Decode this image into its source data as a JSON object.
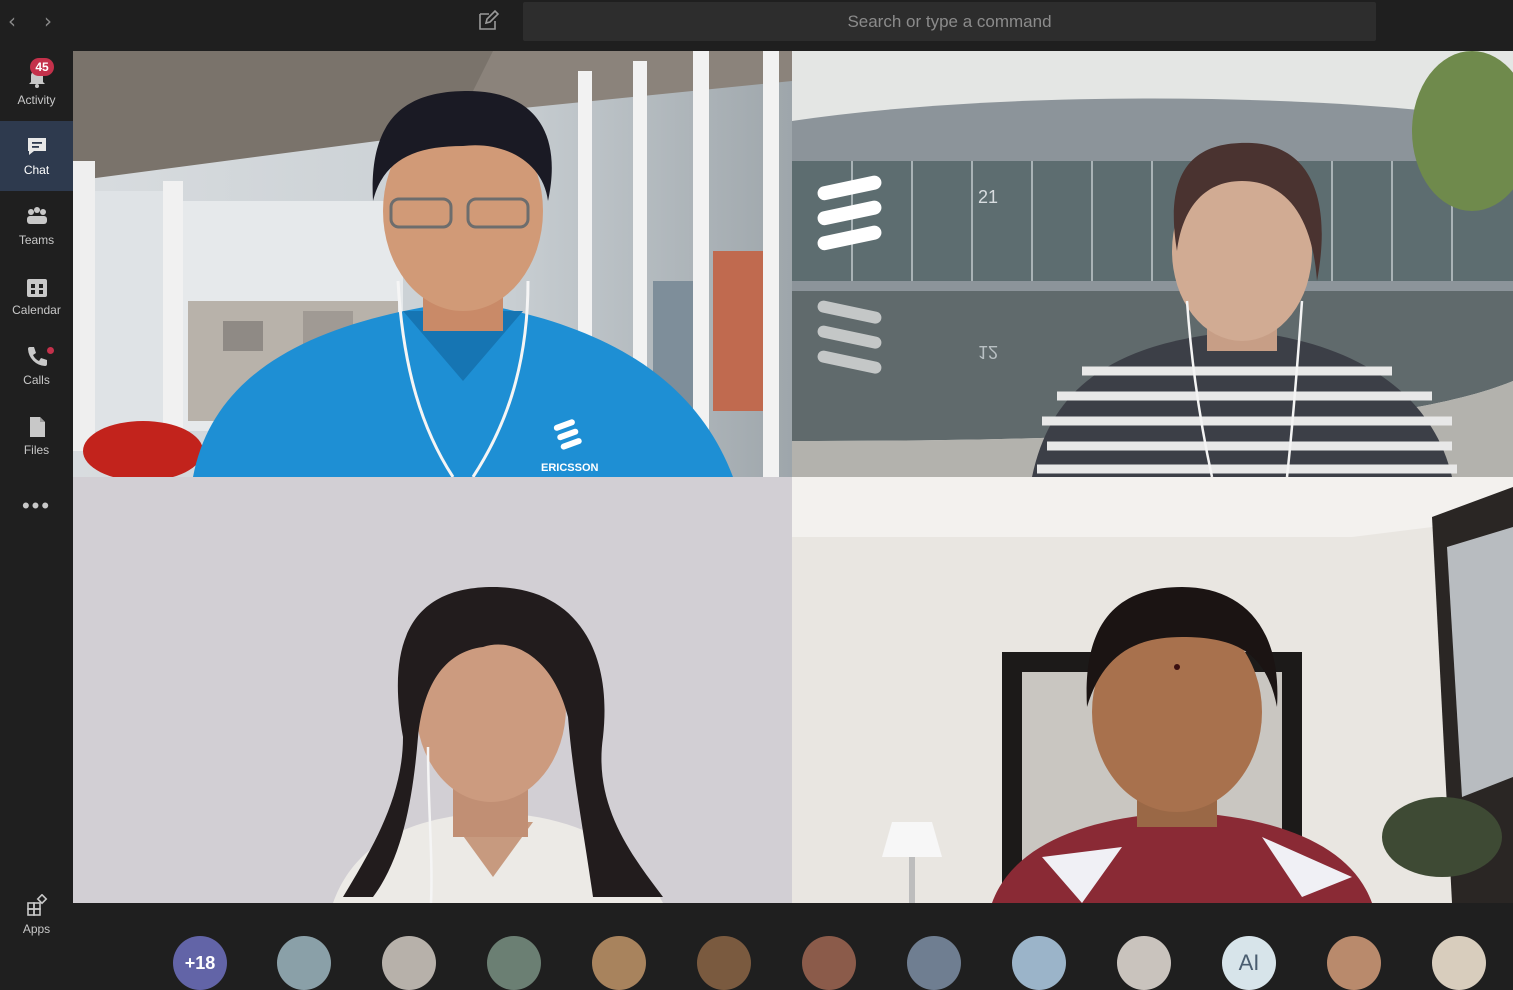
{
  "search": {
    "placeholder": "Search or type a command"
  },
  "nav": {
    "back_glyph": "‹",
    "forward_glyph": "›"
  },
  "rail": {
    "items": [
      {
        "label": "Activity",
        "icon": "bell-icon",
        "badge": "45"
      },
      {
        "label": "Chat",
        "icon": "chat-icon",
        "active": true
      },
      {
        "label": "Teams",
        "icon": "teams-icon"
      },
      {
        "label": "Calendar",
        "icon": "calendar-icon"
      },
      {
        "label": "Calls",
        "icon": "phone-icon",
        "dot": true
      },
      {
        "label": "Files",
        "icon": "file-icon"
      }
    ],
    "more_glyph": "•••",
    "apps_label": "Apps"
  },
  "tiles": [
    {
      "name": "participant-video-1",
      "shirt_text": "ERICSSON"
    },
    {
      "name": "participant-video-2",
      "building_number": "21",
      "building_number_reflection": "12"
    },
    {
      "name": "participant-video-3"
    },
    {
      "name": "participant-video-4"
    }
  ],
  "roster": {
    "overflow_count": "+18",
    "initials": "AI"
  },
  "colors": {
    "accent": "#6264a7",
    "badge": "#c4314b",
    "rail_active": "#2e3a4e"
  }
}
